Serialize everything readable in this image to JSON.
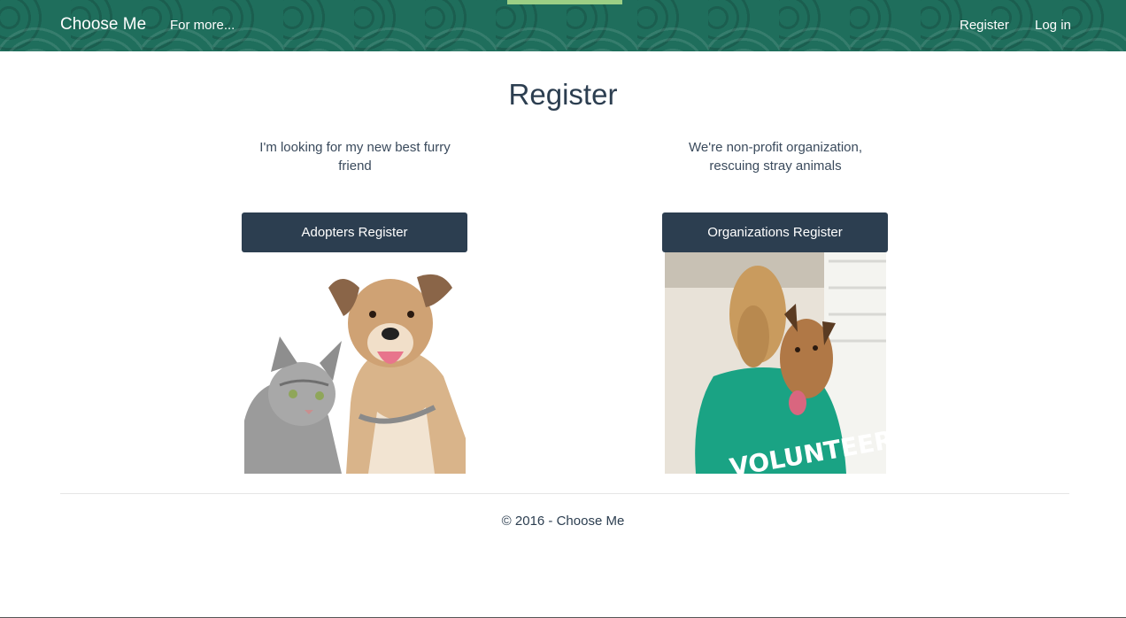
{
  "nav": {
    "brand": "Choose Me",
    "more": "For more...",
    "register": "Register",
    "login": "Log in"
  },
  "page": {
    "title": "Register"
  },
  "adopters": {
    "description": "I'm looking for my new best furry friend",
    "button": "Adopters Register",
    "image": "cat-and-dog-photo"
  },
  "organizations": {
    "description": "We're non-profit organization, rescuing stray animals",
    "button": "Organizations Register",
    "image": "volunteer-hugging-dog-photo",
    "shirt_text": "VOLUNTEER"
  },
  "footer": {
    "text": "© 2016 - Choose Me"
  },
  "colors": {
    "nav_bg": "#1f6e5c",
    "button_bg": "#2c3e50",
    "accent": "#9ccf85"
  }
}
